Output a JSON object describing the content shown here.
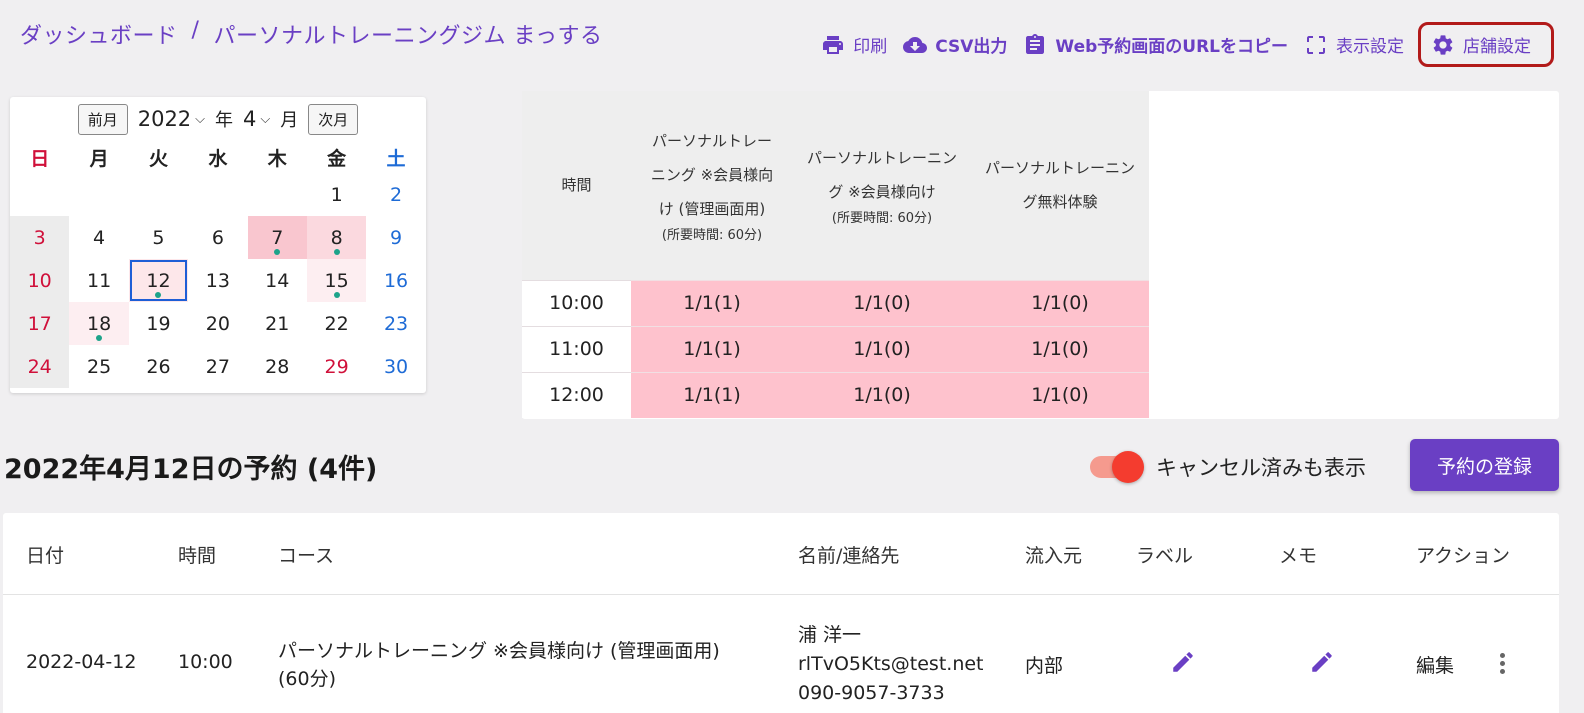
{
  "breadcrumb": {
    "root": "ダッシュボード",
    "sep": "/",
    "current": "パーソナルトレーニングジム まっする"
  },
  "toolbar": {
    "print": "印刷",
    "csv": "CSV出力",
    "copy_url": "Web予約画面のURLをコピー",
    "display": "表示設定",
    "store": "店舗設定"
  },
  "calendar": {
    "prev": "前月",
    "next": "次月",
    "year": "2022",
    "year_unit": "年",
    "month": "4",
    "month_unit": "月",
    "dow": [
      "日",
      "月",
      "火",
      "水",
      "木",
      "金",
      "土"
    ],
    "weeks": [
      [
        "",
        "",
        "",
        "",
        "",
        "1",
        "2"
      ],
      [
        "3",
        "4",
        "5",
        "6",
        "7",
        "8",
        "9"
      ],
      [
        "10",
        "11",
        "12",
        "13",
        "14",
        "15",
        "16"
      ],
      [
        "17",
        "18",
        "19",
        "20",
        "21",
        "22",
        "23"
      ],
      [
        "24",
        "25",
        "26",
        "27",
        "28",
        "29",
        "30"
      ]
    ]
  },
  "slots": {
    "time_header": "時間",
    "courses": [
      {
        "name": "パーソナルトレーニング ※会員様向け (管理画面用)",
        "duration": "(所要時間: 60分)"
      },
      {
        "name": "パーソナルトレーニング ※会員様向け",
        "duration": "(所要時間: 60分)"
      },
      {
        "name": "パーソナルトレーニング無料体験",
        "duration": ""
      }
    ],
    "rows": [
      {
        "time": "10:00",
        "caps": [
          "1/1(1)",
          "1/1(0)",
          "1/1(0)"
        ]
      },
      {
        "time": "11:00",
        "caps": [
          "1/1(1)",
          "1/1(0)",
          "1/1(0)"
        ]
      },
      {
        "time": "12:00",
        "caps": [
          "1/1(1)",
          "1/1(0)",
          "1/1(0)"
        ]
      }
    ]
  },
  "day": {
    "title": "2022年4月12日の予約 (4件)",
    "show_cancelled": "キャンセル済みも表示",
    "register": "予約の登録"
  },
  "reservations": {
    "headers": [
      "日付",
      "時間",
      "コース",
      "名前/連絡先",
      "流入元",
      "ラベル",
      "メモ",
      "アクション"
    ],
    "rows": [
      {
        "date": "2022-04-12",
        "time": "10:00",
        "course": "パーソナルトレーニング ※会員様向け (管理画面用)",
        "course_duration": "(60分)",
        "name": "浦 洋一",
        "email": "rlTvO5Kts@test.net",
        "phone": "090-9057-3733",
        "source": "内部",
        "edit": "編集"
      }
    ]
  },
  "colors": {
    "accent": "#6a3fc4",
    "slot_full": "#fec2cd",
    "sunday": "#d0103a",
    "saturday": "#1e6bd6"
  }
}
